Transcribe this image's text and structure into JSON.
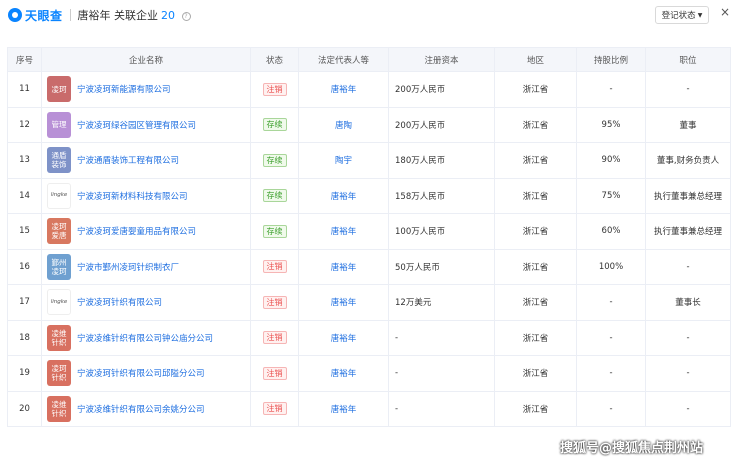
{
  "header": {
    "logo_text": "天眼查",
    "person": "唐裕年",
    "label": "关联企业",
    "count": "20",
    "status_dropdown": "登记状态",
    "close": "×"
  },
  "columns": [
    "序号",
    "企业名称",
    "状态",
    "法定代表人等",
    "注册资本",
    "地区",
    "持股比例",
    "职位"
  ],
  "rows": [
    {
      "no": "11",
      "logo_text": "凌珂",
      "logo_color": "#c96b6b",
      "name": "宁波凌珂新能源有限公司",
      "status": "注销",
      "status_type": "red",
      "rep": "唐裕年",
      "capital": "200万人民币",
      "region": "浙江省",
      "share": "-",
      "position": "-"
    },
    {
      "no": "12",
      "logo_text": "管理",
      "logo_color": "#b890d6",
      "name": "宁波凌珂绿谷园区管理有限公司",
      "status": "存续",
      "status_type": "green",
      "rep": "唐陶",
      "capital": "200万人民币",
      "region": "浙江省",
      "share": "95%",
      "position": "董事"
    },
    {
      "no": "13",
      "logo_text": "通盾装饰",
      "logo_color": "#7e92c8",
      "name": "宁波通盾装饰工程有限公司",
      "status": "存续",
      "status_type": "green",
      "rep": "陶宇",
      "capital": "180万人民币",
      "region": "浙江省",
      "share": "90%",
      "position": "董事,财务负责人"
    },
    {
      "no": "14",
      "logo_text": "lingke",
      "logo_color": "wordmark",
      "name": "宁波凌珂新材料科技有限公司",
      "status": "存续",
      "status_type": "green",
      "rep": "唐裕年",
      "capital": "158万人民币",
      "region": "浙江省",
      "share": "75%",
      "position": "执行董事兼总经理"
    },
    {
      "no": "15",
      "logo_text": "凌珂爱唐",
      "logo_color": "#d87860",
      "name": "宁波凌珂爱唐婴童用品有限公司",
      "status": "存续",
      "status_type": "green",
      "rep": "唐裕年",
      "capital": "100万人民币",
      "region": "浙江省",
      "share": "60%",
      "position": "执行董事兼总经理"
    },
    {
      "no": "16",
      "logo_text": "鄞州凌珂",
      "logo_color": "#6fa0d0",
      "name": "宁波市鄞州凌珂针织制衣厂",
      "status": "注销",
      "status_type": "red",
      "rep": "唐裕年",
      "capital": "50万人民币",
      "region": "浙江省",
      "share": "100%",
      "position": "-"
    },
    {
      "no": "17",
      "logo_text": "lingke",
      "logo_color": "wordmark",
      "name": "宁波凌珂针织有限公司",
      "status": "注销",
      "status_type": "red",
      "rep": "唐裕年",
      "capital": "12万美元",
      "region": "浙江省",
      "share": "-",
      "position": "董事长"
    },
    {
      "no": "18",
      "logo_text": "凌维针织",
      "logo_color": "#d87060",
      "name": "宁波凌维针织有限公司钟公庙分公司",
      "status": "注销",
      "status_type": "red",
      "rep": "唐裕年",
      "capital": "-",
      "region": "浙江省",
      "share": "-",
      "position": "-"
    },
    {
      "no": "19",
      "logo_text": "凌珂针织",
      "logo_color": "#d87060",
      "name": "宁波凌珂针织有限公司邱隘分公司",
      "status": "注销",
      "status_type": "red",
      "rep": "唐裕年",
      "capital": "-",
      "region": "浙江省",
      "share": "-",
      "position": "-"
    },
    {
      "no": "20",
      "logo_text": "凌维针织",
      "logo_color": "#d87060",
      "name": "宁波凌维针织有限公司余姚分公司",
      "status": "注销",
      "status_type": "red",
      "rep": "唐裕年",
      "capital": "-",
      "region": "浙江省",
      "share": "-",
      "position": "-"
    }
  ],
  "watermark": "搜狐号@搜狐焦点荆州站"
}
